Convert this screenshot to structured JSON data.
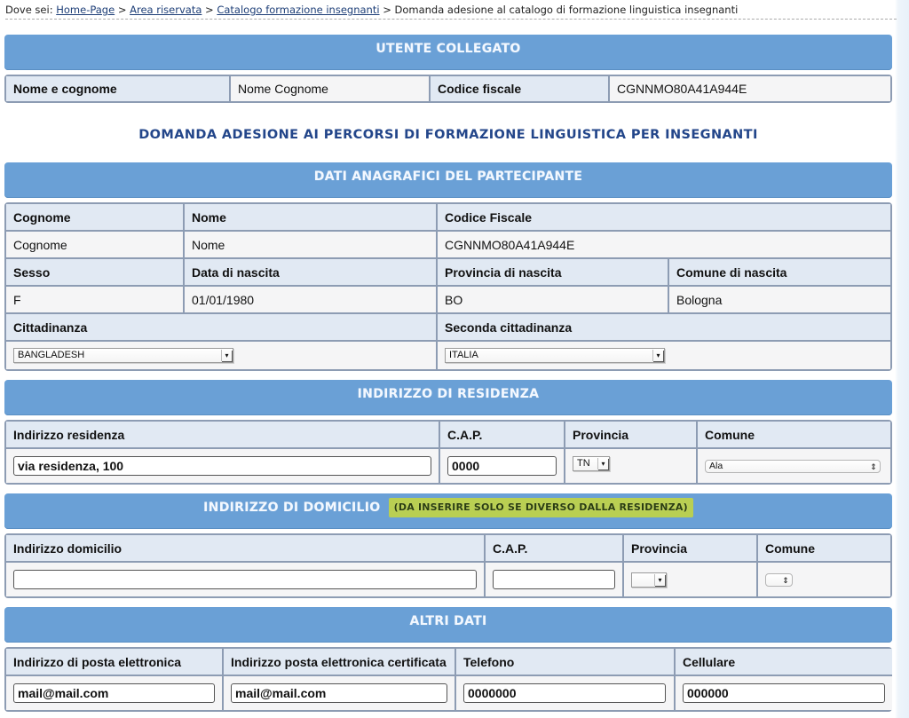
{
  "breadcrumb": {
    "prefix": "Dove sei:",
    "links": [
      "Home-Page",
      "Area riservata",
      "Catalogo formazione insegnanti"
    ],
    "separator": ">",
    "current": "Domanda adesione al catalogo di formazione linguistica insegnanti"
  },
  "utente": {
    "header": "UTENTE COLLEGATO",
    "nome_label": "Nome e cognome",
    "nome_value": "Nome Cognome",
    "cf_label": "Codice fiscale",
    "cf_value": "CGNNMO80A41A944E"
  },
  "page_title": "DOMANDA ADESIONE AI PERCORSI DI FORMAZIONE LINGUISTICA PER INSEGNANTI",
  "anagrafica": {
    "header": "DATI ANAGRAFICI DEL PARTECIPANTE",
    "cognome_label": "Cognome",
    "cognome_value": "Cognome",
    "nome_label": "Nome",
    "nome_value": "Nome",
    "cf_label": "Codice Fiscale",
    "cf_value": "CGNNMO80A41A944E",
    "sesso_label": "Sesso",
    "sesso_value": "F",
    "data_label": "Data di nascita",
    "data_value": "01/01/1980",
    "provincia_label": "Provincia di nascita",
    "provincia_value": "BO",
    "comune_label": "Comune di nascita",
    "comune_value": "Bologna",
    "cittadinanza_label": "Cittadinanza",
    "cittadinanza_value": "BANGLADESH",
    "seconda_label": "Seconda cittadinanza",
    "seconda_value": "ITALIA"
  },
  "residenza": {
    "header": "INDIRIZZO DI RESIDENZA",
    "indirizzo_label": "Indirizzo residenza",
    "indirizzo_value": "via residenza, 100",
    "cap_label": "C.A.P.",
    "cap_value": "0000",
    "provincia_label": "Provincia",
    "provincia_value": "TN",
    "comune_label": "Comune",
    "comune_value": "Ala"
  },
  "domicilio": {
    "header": "INDIRIZZO DI DOMICILIO",
    "note": "(DA INSERIRE SOLO SE DIVERSO DALLA RESIDENZA)",
    "indirizzo_label": "Indirizzo domicilio",
    "indirizzo_value": "",
    "cap_label": "C.A.P.",
    "cap_value": "",
    "provincia_label": "Provincia",
    "provincia_value": "",
    "comune_label": "Comune",
    "comune_value": ""
  },
  "altri": {
    "header": "ALTRI DATI",
    "email_label": "Indirizzo di posta elettronica",
    "email_value": "mail@mail.com",
    "pec_label": "Indirizzo posta elettronica certificata",
    "pec_value": "mail@mail.com",
    "telefono_label": "Telefono",
    "telefono_value": "0000000",
    "cellulare_label": "Cellulare",
    "cellulare_value": "000000"
  },
  "icons": {
    "select_arrow": "▾",
    "select_updown": "⇕"
  }
}
